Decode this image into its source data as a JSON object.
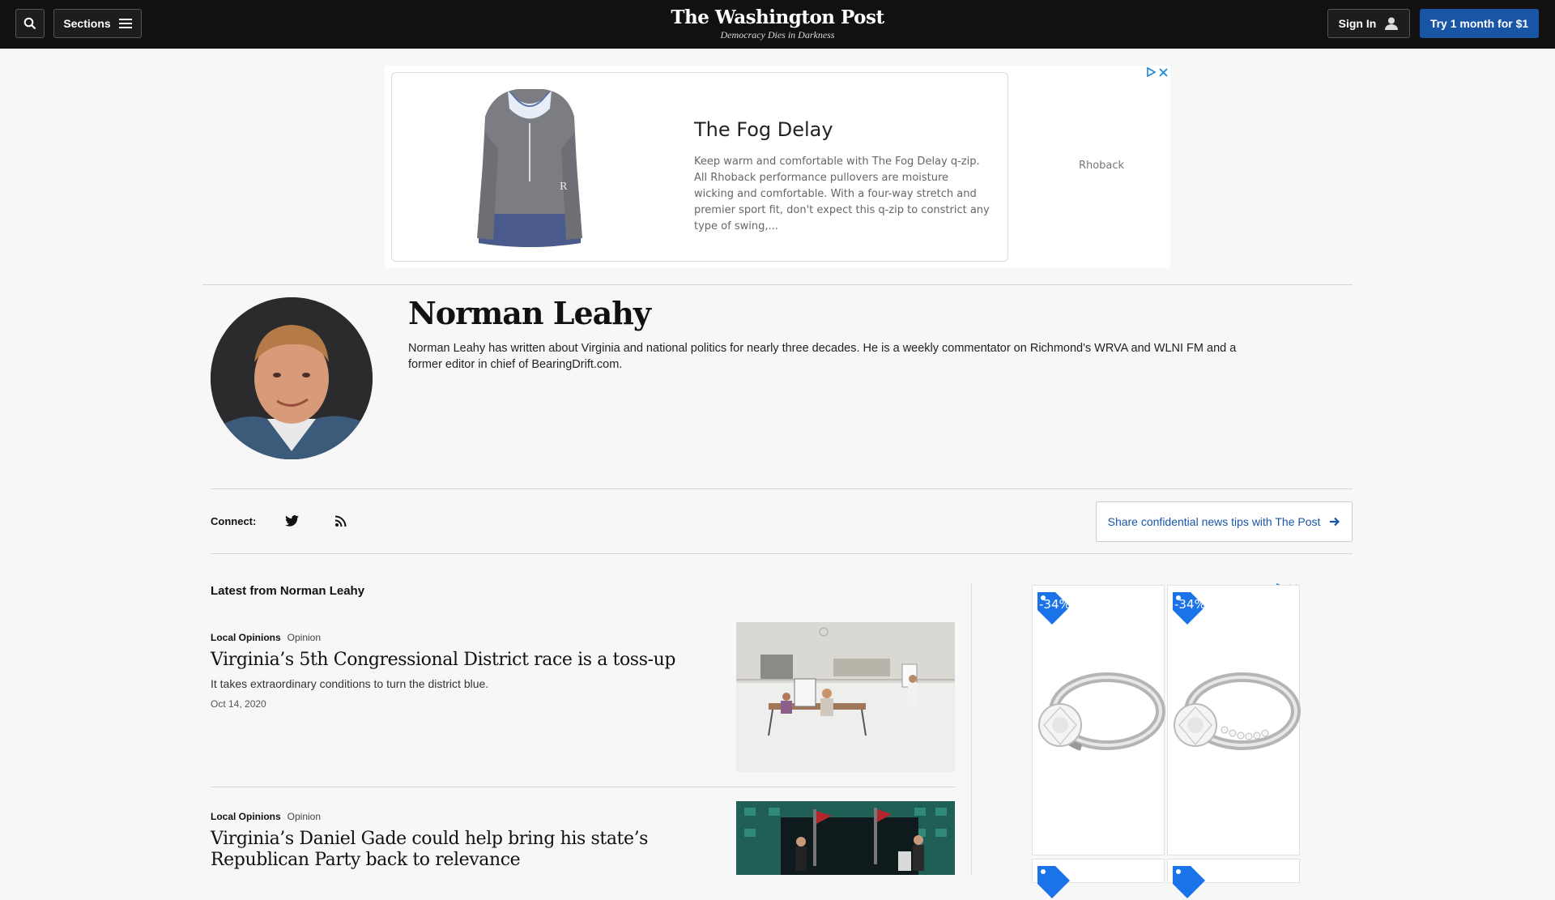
{
  "nav": {
    "sections_label": "Sections",
    "logo_name": "The Washington Post",
    "logo_tagline": "Democracy Dies in Darkness",
    "signin_label": "Sign In",
    "subscribe_label": "Try 1 month for $1"
  },
  "top_ad": {
    "title": "The Fog Delay",
    "description": "Keep warm and comfortable with The Fog Delay q-zip. All Rhoback performance pullovers are moisture wicking and comfortable. With a four-way stretch and premier sport fit, don't expect this q-zip to constrict any type of swing,...",
    "brand": "Rhoback"
  },
  "author": {
    "name": "Norman Leahy",
    "bio": "Norman Leahy has written about Virginia and national politics for nearly three decades. He is a weekly commentator on Richmond's WRVA and WLNI FM and a former editor in chief of BearingDrift.com."
  },
  "connect": {
    "label": "Connect:",
    "icons": [
      "twitter-icon",
      "rss-icon"
    ],
    "tips_label": "Share confidential news tips with The Post"
  },
  "latest": {
    "title": "Latest from Norman Leahy",
    "stories": [
      {
        "section": "Local Opinions",
        "type": "Opinion",
        "headline": "Virginia’s 5th Congressional District race is a toss-up",
        "blurb": "It takes extraordinary conditions to turn the district blue.",
        "date": "Oct 14, 2020"
      },
      {
        "section": "Local Opinions",
        "type": "Opinion",
        "headline": "Virginia’s Daniel Gade could help bring his state’s Republican Party back to relevance"
      }
    ]
  },
  "right_ad": {
    "badges": [
      "-34%",
      "-34%"
    ]
  },
  "colors": {
    "nav_bg": "#111111",
    "accent_blue": "#1955a5",
    "page_bg": "#f7f7f7"
  }
}
